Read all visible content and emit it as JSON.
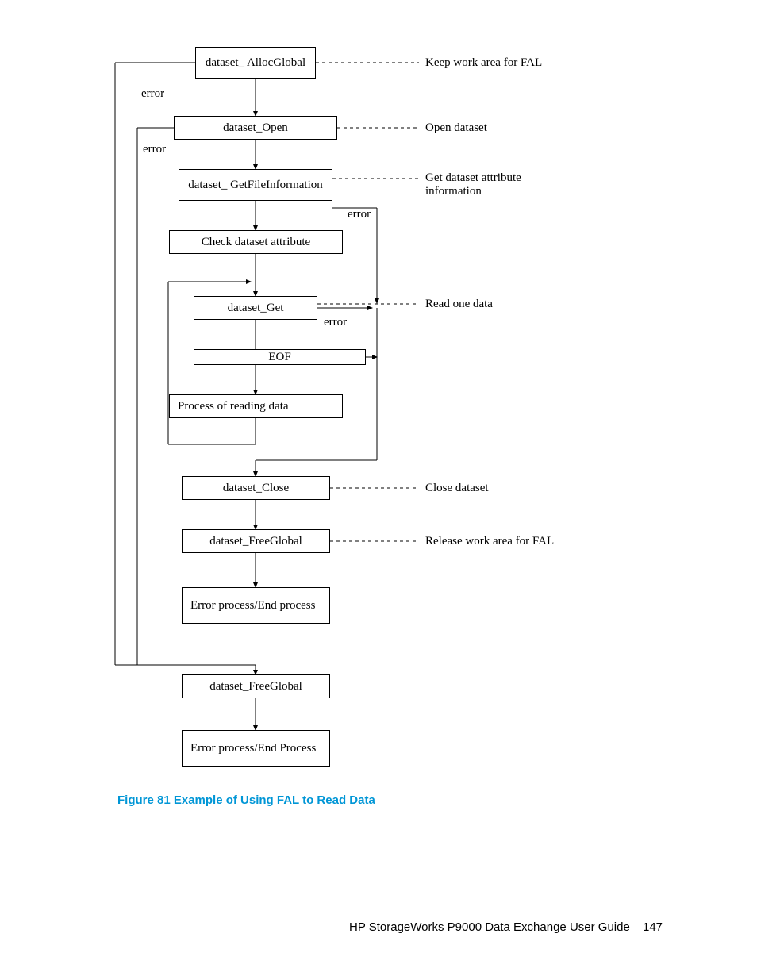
{
  "boxes": {
    "alloc": "dataset_ AllocGlobal",
    "open": "dataset_Open",
    "getinfo": "dataset_ GetFileInformation",
    "check": "Check dataset attribute",
    "get": "dataset_Get",
    "eof": "EOF",
    "process": "Process of reading data",
    "close": "dataset_Close",
    "free1": "dataset_FreeGlobal",
    "err1": "Error process/End process",
    "free2": "dataset_FreeGlobal",
    "err2": "Error process/End Process"
  },
  "annotations": {
    "alloc": "Keep work area for FAL",
    "open": "Open dataset",
    "getinfo": "Get dataset attribute information",
    "get": "Read one data",
    "close": "Close dataset",
    "free1": "Release work area for FAL"
  },
  "errors": {
    "alloc": "error",
    "open": "error",
    "getinfo": "error",
    "get": "error"
  },
  "caption": "Figure 81 Example of Using FAL to Read Data",
  "footer": "HP StorageWorks P9000 Data Exchange User Guide",
  "page": "147"
}
